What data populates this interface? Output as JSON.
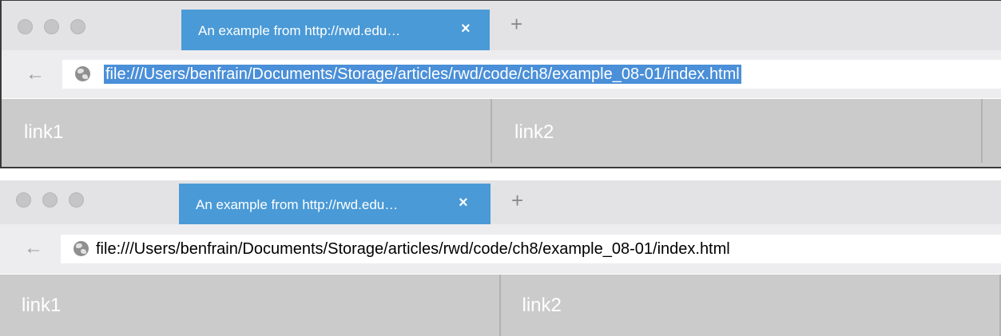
{
  "windows": [
    {
      "tab": {
        "title": "An example from http://rwd.edu…",
        "close": "×"
      },
      "new_tab": "+",
      "back": "←",
      "url": "file:///Users/benfrain/Documents/Storage/articles/rwd/code/ch8/example_08-01/index.html",
      "url_selected": true,
      "nav": [
        "link1",
        "link2"
      ]
    },
    {
      "tab": {
        "title": "An example from http://rwd.edu…",
        "close": "×"
      },
      "new_tab": "+",
      "back": "←",
      "url": "file:///Users/benfrain/Documents/Storage/articles/rwd/code/ch8/example_08-01/index.html",
      "url_selected": false,
      "nav": [
        "link1",
        "link2"
      ]
    }
  ],
  "colors": {
    "tab_active": "#4a9ad7",
    "url_selection": "#4a8fd8",
    "nav_bg": "#cbcbcb"
  }
}
